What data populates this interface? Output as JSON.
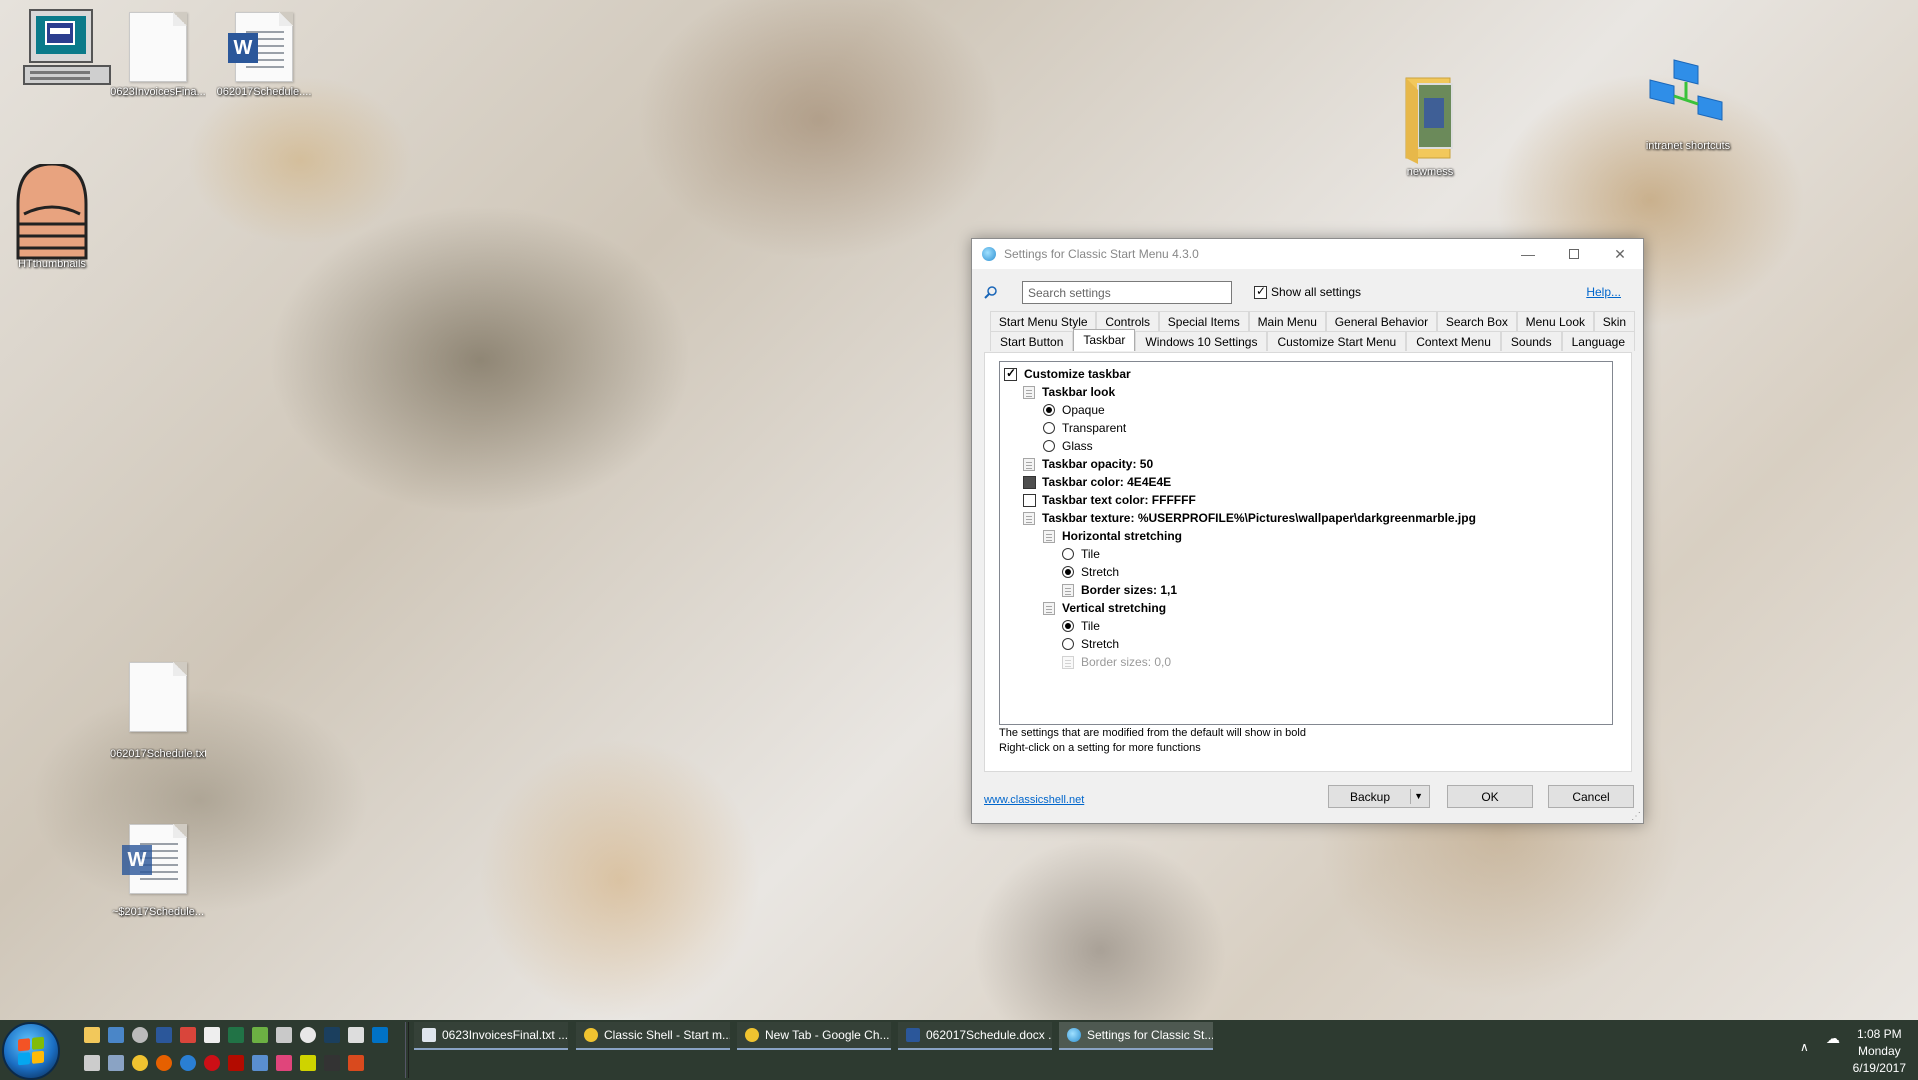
{
  "desktop": {
    "icons": [
      {
        "label": ""
      },
      {
        "label": "0623InvoicesFina..."
      },
      {
        "label": "062017Schedule...."
      },
      {
        "label": "newmess"
      },
      {
        "label": "intranet shortcuts"
      },
      {
        "label": "HTthumbnails"
      },
      {
        "label": "062017Schedule.txt"
      },
      {
        "label": "~$2017Schedule..."
      }
    ]
  },
  "dialog": {
    "title": "Settings for Classic Start Menu 4.3.0",
    "search_placeholder": "Search settings",
    "show_all_label": "Show all settings",
    "help_label": "Help...",
    "tabs_row1": [
      "Start Menu Style",
      "Controls",
      "Special Items",
      "Main Menu",
      "General Behavior",
      "Search Box",
      "Menu Look",
      "Skin"
    ],
    "tabs_row2": [
      "Start Button",
      "Taskbar",
      "Windows 10 Settings",
      "Customize Start Menu",
      "Context Menu",
      "Sounds",
      "Language"
    ],
    "active_tab": "Taskbar",
    "tree": {
      "customize_taskbar": "Customize taskbar",
      "taskbar_look": "Taskbar look",
      "opaque": "Opaque",
      "transparent": "Transparent",
      "glass": "Glass",
      "taskbar_opacity": "Taskbar opacity: 50",
      "taskbar_color": "Taskbar color: 4E4E4E",
      "taskbar_text_color": "Taskbar text color: FFFFFF",
      "taskbar_texture": "Taskbar texture: %USERPROFILE%\\Pictures\\wallpaper\\darkgreenmarble.jpg",
      "horizontal_stretching": "Horizontal stretching",
      "h_tile": "Tile",
      "h_stretch": "Stretch",
      "h_border_sizes": "Border sizes: 1,1",
      "vertical_stretching": "Vertical stretching",
      "v_tile": "Tile",
      "v_stretch": "Stretch",
      "v_border_sizes": "Border sizes: 0,0"
    },
    "colors": {
      "taskbar_color": "#4E4E4E",
      "taskbar_text_color": "#FFFFFF"
    },
    "note1": "The settings that are modified from the default will show in bold",
    "note2": "Right-click on a setting for more functions",
    "site_link": "www.classicshell.net",
    "backup_label": "Backup",
    "ok_label": "OK",
    "cancel_label": "Cancel"
  },
  "taskbar": {
    "buttons": [
      "0623InvoicesFinal.txt ...",
      "Classic Shell - Start m...",
      "New Tab - Google Ch...",
      "062017Schedule.docx ...",
      "Settings for Classic St..."
    ],
    "clock_time": "1:08 PM",
    "clock_day": "Monday",
    "clock_date": "6/19/2017"
  }
}
